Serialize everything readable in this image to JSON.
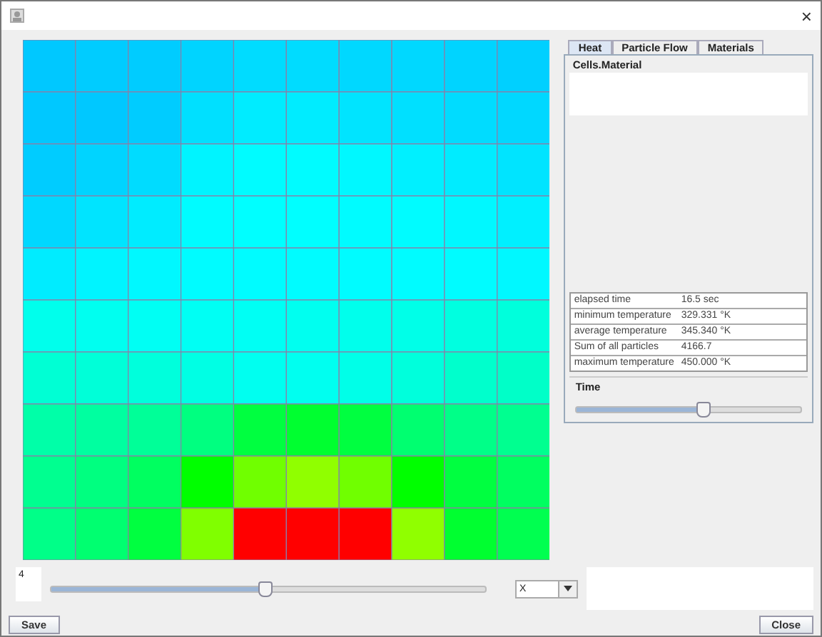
{
  "window": {
    "close": "×"
  },
  "heat_grid": {
    "rows": [
      {
        "cells": [
          {
            "color": "#00c8ff"
          },
          {
            "color": "#00ccff"
          },
          {
            "color": "#00ccff"
          },
          {
            "color": "#00d4ff"
          },
          {
            "color": "#00dcff"
          },
          {
            "color": "#00dcff"
          },
          {
            "color": "#00d8ff"
          },
          {
            "color": "#00d8ff"
          },
          {
            "color": "#00d4ff"
          },
          {
            "color": "#00d0ff"
          }
        ]
      },
      {
        "cells": [
          {
            "color": "#00c8ff"
          },
          {
            "color": "#00c8ff"
          },
          {
            "color": "#00ccff"
          },
          {
            "color": "#00e0ff"
          },
          {
            "color": "#00ecff"
          },
          {
            "color": "#00ecff"
          },
          {
            "color": "#00e4ff"
          },
          {
            "color": "#00e0ff"
          },
          {
            "color": "#00dcff"
          },
          {
            "color": "#00d8ff"
          }
        ]
      },
      {
        "cells": [
          {
            "color": "#00ccff"
          },
          {
            "color": "#00d4ff"
          },
          {
            "color": "#00dcff"
          },
          {
            "color": "#00f4ff"
          },
          {
            "color": "#00fcff"
          },
          {
            "color": "#00fcff"
          },
          {
            "color": "#00f8ff"
          },
          {
            "color": "#00f0ff"
          },
          {
            "color": "#00ecff"
          },
          {
            "color": "#00e4ff"
          }
        ]
      },
      {
        "cells": [
          {
            "color": "#00d8ff"
          },
          {
            "color": "#00e4ff"
          },
          {
            "color": "#00ecff"
          },
          {
            "color": "#00fcff"
          },
          {
            "color": "#00ffff"
          },
          {
            "color": "#00ffff"
          },
          {
            "color": "#00fcff"
          },
          {
            "color": "#00fcff"
          },
          {
            "color": "#00f8ff"
          },
          {
            "color": "#00f0ff"
          }
        ]
      },
      {
        "cells": [
          {
            "color": "#00ecff"
          },
          {
            "color": "#00f4ff"
          },
          {
            "color": "#00f8ff"
          },
          {
            "color": "#00fcff"
          },
          {
            "color": "#00fcff"
          },
          {
            "color": "#00fcff"
          },
          {
            "color": "#00fcff"
          },
          {
            "color": "#00fcff"
          },
          {
            "color": "#00fcff"
          },
          {
            "color": "#00f8ff"
          }
        ]
      },
      {
        "cells": [
          {
            "color": "#00ffec"
          },
          {
            "color": "#00fff0"
          },
          {
            "color": "#00fff4"
          },
          {
            "color": "#00fff4"
          },
          {
            "color": "#00fff4"
          },
          {
            "color": "#00fff0"
          },
          {
            "color": "#00ffec"
          },
          {
            "color": "#00ffe8"
          },
          {
            "color": "#00ffe0"
          },
          {
            "color": "#00ffdc"
          }
        ]
      },
      {
        "cells": [
          {
            "color": "#00ffd4"
          },
          {
            "color": "#00ffd8"
          },
          {
            "color": "#00ffdc"
          },
          {
            "color": "#00ffe4"
          },
          {
            "color": "#00fff0"
          },
          {
            "color": "#00fff0"
          },
          {
            "color": "#00ffe8"
          },
          {
            "color": "#00ffdc"
          },
          {
            "color": "#00ffcc"
          },
          {
            "color": "#00ffc8"
          }
        ]
      },
      {
        "cells": [
          {
            "color": "#00ffa8"
          },
          {
            "color": "#00ffa0"
          },
          {
            "color": "#00ff98"
          },
          {
            "color": "#00ff80"
          },
          {
            "color": "#00ff40"
          },
          {
            "color": "#00ff30"
          },
          {
            "color": "#00ff40"
          },
          {
            "color": "#00ff70"
          },
          {
            "color": "#00ff88"
          },
          {
            "color": "#00ff90"
          }
        ]
      },
      {
        "cells": [
          {
            "color": "#00ff90"
          },
          {
            "color": "#00ff80"
          },
          {
            "color": "#00ff60"
          },
          {
            "color": "#00ff00"
          },
          {
            "color": "#70ff00"
          },
          {
            "color": "#90ff00"
          },
          {
            "color": "#70ff00"
          },
          {
            "color": "#00ff00"
          },
          {
            "color": "#00ff40"
          },
          {
            "color": "#00ff60"
          }
        ]
      },
      {
        "cells": [
          {
            "color": "#00ff88"
          },
          {
            "color": "#00ff70"
          },
          {
            "color": "#00ff40"
          },
          {
            "color": "#80ff00"
          },
          {
            "color": "#ff0000"
          },
          {
            "color": "#ff0000"
          },
          {
            "color": "#ff0000"
          },
          {
            "color": "#90ff00"
          },
          {
            "color": "#00ff30"
          },
          {
            "color": "#00ff50"
          }
        ]
      }
    ]
  },
  "tabs": [
    {
      "label": "Heat",
      "selected": true
    },
    {
      "label": "Particle Flow",
      "selected": false
    },
    {
      "label": "Materials",
      "selected": false
    }
  ],
  "list": {
    "header": "Cells.Material"
  },
  "stats": [
    {
      "name": "elapsed time",
      "value": "16.5 sec"
    },
    {
      "name": "minimum temperature",
      "value": "329.331 °K"
    },
    {
      "name": "average temperature",
      "value": "345.340 °K"
    },
    {
      "name": "Sum of all particles",
      "value": "4166.7"
    },
    {
      "name": "maximum temperature",
      "value": "450.000 °K"
    }
  ],
  "time": {
    "title": "Time",
    "level": 0.56
  },
  "layer": {
    "value": "4",
    "level": 0.49,
    "axis": "X"
  },
  "buttons": {
    "save": "Save",
    "close": "Close"
  }
}
